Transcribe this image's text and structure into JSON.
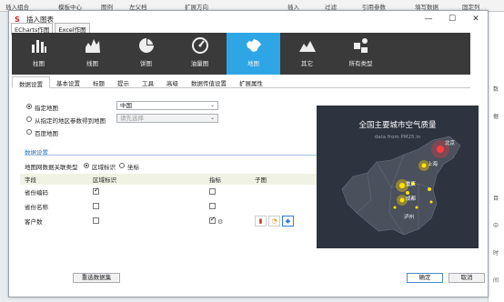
{
  "background": {
    "toolbar": [
      "插入组合",
      "模板中心",
      "图例",
      "左父档",
      "扩展方向",
      "插入",
      "过滤",
      "引用参数",
      "填写数据",
      "固定列"
    ],
    "right_strip": [
      "数",
      "据",
      "目",
      "中",
      "时",
      "间"
    ]
  },
  "dialog": {
    "title": "插入图表",
    "window_buttons": {
      "minimize": "—",
      "maximize": "☐",
      "close": "✕"
    },
    "top_tabs": [
      "ECharts作图",
      "Excel作图"
    ],
    "chart_types": [
      {
        "label": "柱图",
        "icon": "bar-chart-icon"
      },
      {
        "label": "线图",
        "icon": "line-chart-icon"
      },
      {
        "label": "饼图",
        "icon": "pie-chart-icon"
      },
      {
        "label": "油量图",
        "icon": "gauge-chart-icon"
      },
      {
        "label": "地图",
        "icon": "map-chart-icon"
      },
      {
        "label": "其它",
        "icon": "other-chart-icon"
      },
      {
        "label": "所有类型",
        "icon": "all-types-icon"
      }
    ],
    "active_chart_type": "地图",
    "sub_tabs": [
      "数据设置",
      "基本设置",
      "标题",
      "提示",
      "工具",
      "高级",
      "数据传值设置",
      "扩展属性"
    ],
    "active_sub_tab": "数据设置",
    "map_source": {
      "options": [
        "指定地图",
        "从指定的地区参数得到地图",
        "百度地图"
      ],
      "selected": "指定地图",
      "map_select_value": "中国",
      "param_select_placeholder": "请先选择"
    },
    "data_settings": {
      "section_title": "数据设置",
      "field_type_label": "地图网数据关联类型",
      "field_type_options": [
        "区域标识",
        "坐标"
      ],
      "field_type_selected": "区域标识",
      "columns": [
        "字段",
        "区域标识",
        "指标",
        "子图"
      ],
      "rows": [
        {
          "field": "省份编码",
          "region_checked": true,
          "metric_checked": false,
          "has_subchart": false
        },
        {
          "field": "省份名称",
          "region_checked": false,
          "metric_checked": false,
          "has_subchart": false
        },
        {
          "field": "客户数",
          "region_checked": false,
          "metric_checked": true,
          "has_subchart": true
        }
      ]
    },
    "preview": {
      "title": "全国主要城市空气质量",
      "subtitle": "data from PM25.in",
      "cities": [
        "北京",
        "上海",
        "重庆",
        "成都",
        "泸州"
      ]
    },
    "buttons": {
      "reselect": "重选数据集",
      "confirm": "确定",
      "cancel": "取消"
    }
  }
}
